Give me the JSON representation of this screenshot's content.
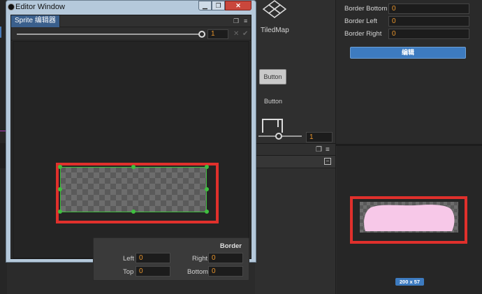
{
  "editor_window": {
    "title": "Editor Window",
    "controls": {
      "minimize": "▁",
      "restore": "❐",
      "close": "✕"
    },
    "tab_label": "Sprite 编辑器",
    "zoom_value": "1",
    "border_panel": {
      "title": "Border",
      "left_label": "Left",
      "left_value": "0",
      "top_label": "Top",
      "top_value": "0",
      "right_label": "Right",
      "right_value": "0",
      "bottom_label": "Bottom",
      "bottom_value": "0"
    }
  },
  "middle": {
    "tiledmap_label": "TiledMap",
    "button_preview_label": "Button",
    "button_label": "Button",
    "zoom_value": "1"
  },
  "inspector": {
    "border_bottom_label": "Border Bottom",
    "border_bottom_value": "0",
    "border_left_label": "Border Left",
    "border_left_value": "0",
    "border_right_label": "Border Right",
    "border_right_value": "0",
    "edit_button_label": "编辑",
    "size_badge": "200 x 57"
  },
  "colors": {
    "highlight_red": "#e0302c",
    "handle_green": "#3fbf3f",
    "accent_blue": "#3d7bc0",
    "value_orange": "#e8952c",
    "preview_pink": "#f7c8e8"
  }
}
